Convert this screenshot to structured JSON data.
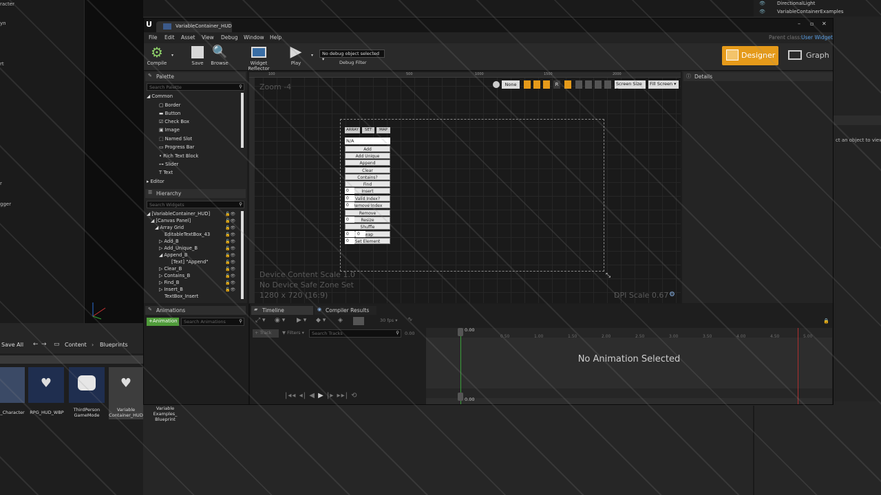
{
  "background": {
    "left_items": [
      "racter",
      "yn",
      "rt",
      "r",
      "gger"
    ],
    "right_outliner": [
      "DirectionalLight",
      "VariableContainerExamples"
    ],
    "right_hint": "ct an object to view d",
    "content_bar": {
      "save_all": "Save All",
      "path": [
        "Content",
        "Blueprints"
      ]
    },
    "assets": [
      "_Character",
      "RPG_HUD_WBP",
      "ThirdPerson GameMode",
      "Variable Container_HUD",
      "Variable Examples_ Blueprint"
    ]
  },
  "window": {
    "tab_title": "VariableContainer_HUD",
    "parent_class_label": "Parent class:",
    "parent_class_value": "User Widget",
    "menu": [
      "File",
      "Edit",
      "Asset",
      "View",
      "Debug",
      "Window",
      "Help"
    ],
    "toolbar": {
      "compile": "Compile",
      "save": "Save",
      "browse": "Browse",
      "widget_reflector": "Widget Reflector",
      "play": "Play",
      "debug_select": "No debug object selected",
      "debug_filter": "Debug Filter",
      "designer": "Designer",
      "graph": "Graph"
    },
    "palette": {
      "title": "Palette",
      "search_placeholder": "Search Palette",
      "category": "Common",
      "items": [
        "Border",
        "Button",
        "Check Box",
        "Image",
        "Named Slot",
        "Progress Bar",
        "Rich Text Block",
        "Slider",
        "Text"
      ],
      "category2": "Editor"
    },
    "hierarchy": {
      "title": "Hierarchy",
      "search_placeholder": "Search Widgets",
      "items": [
        "[VariableContainer_HUD]",
        "[Canvas Panel]",
        "Array Grid",
        "EditableTextBox_43",
        "Add_B",
        "Add_Unique_B",
        "Append_B",
        "[Text] \"Append\"",
        "Clear_B",
        "Contains_B",
        "Find_B",
        "Insert_B",
        "TextBox_Insert"
      ]
    },
    "designer": {
      "zoom": "Zoom -4",
      "ruler": [
        "100",
        "500",
        "1000",
        "1500",
        "2000"
      ],
      "toolbar": {
        "none": "None",
        "r": "R",
        "screen_size": "Screen Size",
        "fill_screen": "Fill Screen"
      },
      "tabs": [
        "ARRAY",
        "SET",
        "MAP"
      ],
      "text_field": "N/A",
      "buttons": [
        "Add",
        "Add Unique",
        "Append",
        "Clear",
        "Contains?",
        "Find",
        "Insert",
        "Valid Index?",
        "Remove Index",
        "Remove",
        "Resize",
        "Shuffle",
        "Swap",
        "Set Element"
      ],
      "zero": "0",
      "info": [
        "Device Content Scale 1.0",
        "No Device Safe Zone Set",
        "1280 x 720 (16:9)"
      ],
      "dpi": "DPI Scale 0.67"
    },
    "details": {
      "title": "Details"
    },
    "animations": {
      "title": "Animations",
      "add": "+Animation",
      "search_placeholder": "Search Animations"
    },
    "timeline": {
      "tabs": [
        "Timeline",
        "Compiler Results"
      ],
      "fps": "30 fps",
      "track": "+ Track",
      "filters": "Filters",
      "search_placeholder": "Search Tracks",
      "time_start": "0.00",
      "ticks": [
        "0.00",
        "0.50",
        "1.00",
        "1.50",
        "2.00",
        "2.50",
        "3.00",
        "3.50",
        "4.00",
        "4.50",
        "5.00"
      ],
      "no_animation": "No Animation Selected"
    }
  }
}
